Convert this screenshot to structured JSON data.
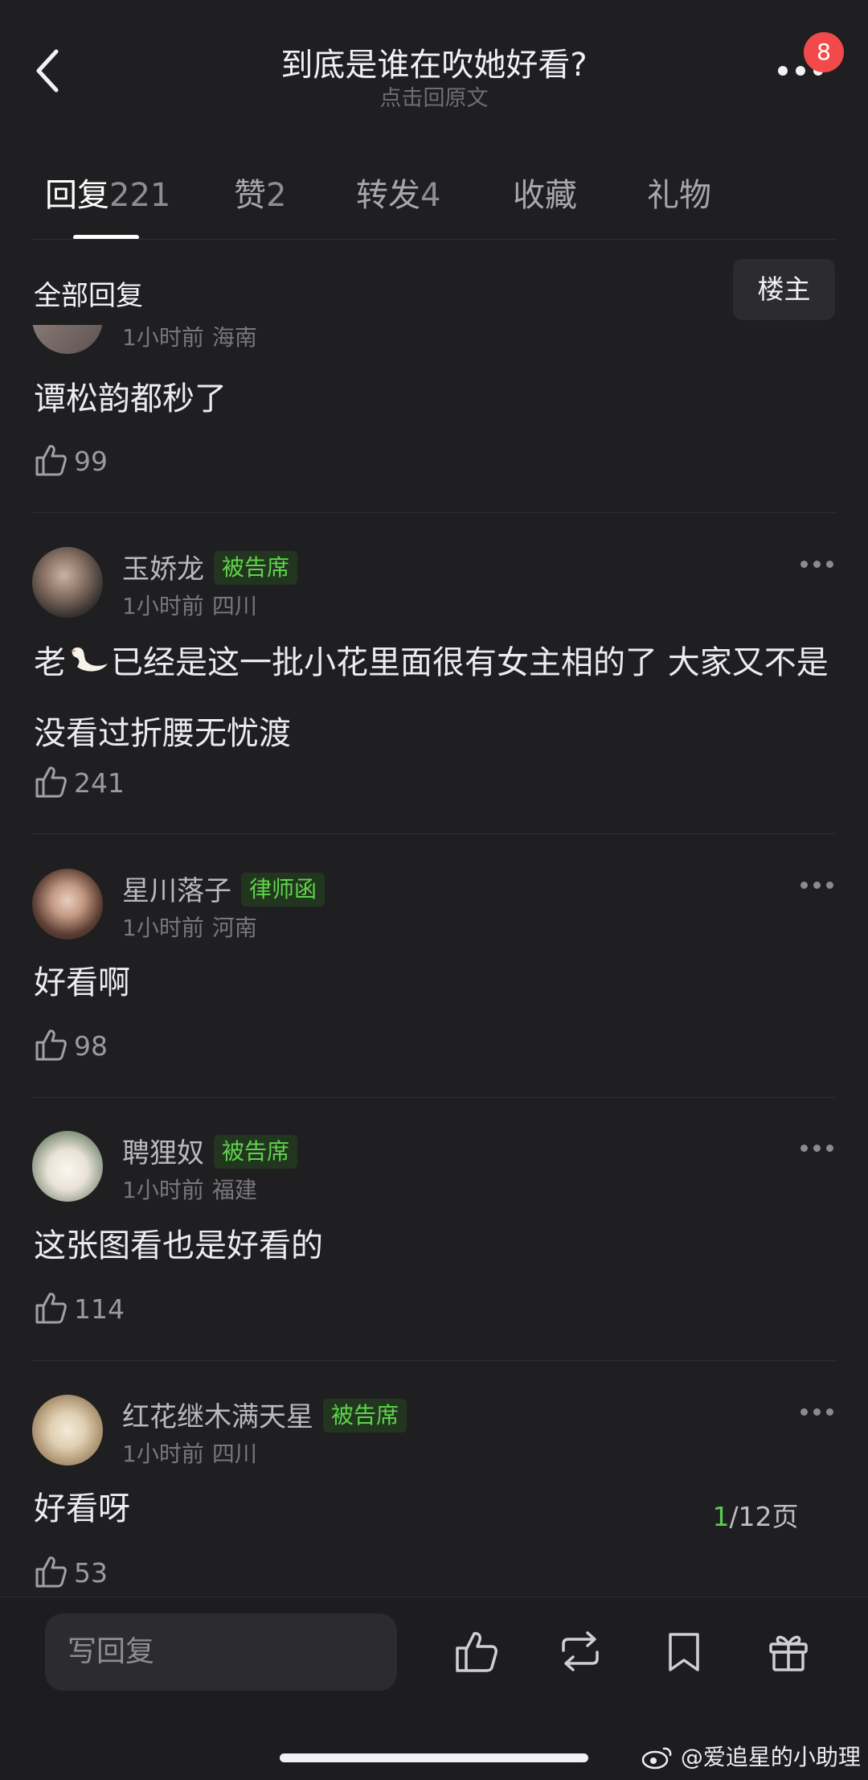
{
  "header": {
    "title": "到底是谁在吹她好看?",
    "subtitle": "点击回原文",
    "notification_count": "8"
  },
  "tabs": [
    {
      "label": "回复",
      "count": "221"
    },
    {
      "label": "赞",
      "count": "2"
    },
    {
      "label": "转发",
      "count": "4"
    },
    {
      "label": "收藏",
      "count": ""
    },
    {
      "label": "礼物",
      "count": ""
    }
  ],
  "filter": {
    "label": "全部回复",
    "op_button": "楼主"
  },
  "comments": [
    {
      "meta_time": "1小时前",
      "meta_loc": "海南",
      "text": "谭松韵都秒了",
      "likes": "99"
    },
    {
      "name": "玉娇龙",
      "tag": "被告席",
      "meta_time": "1小时前",
      "meta_loc": "四川",
      "text_a": "老",
      "text_b": "已经是这一批小花里面很有女主相的了 大家又不是没看过折腰无忧渡",
      "emoji": "swan",
      "likes": "241"
    },
    {
      "name": "星川落子",
      "tag": "律师函",
      "meta_time": "1小时前",
      "meta_loc": "河南",
      "text": "好看啊",
      "likes": "98"
    },
    {
      "name": "聘狸奴",
      "tag": "被告席",
      "meta_time": "1小时前",
      "meta_loc": "福建",
      "text": "这张图看也是好看的",
      "likes": "114"
    },
    {
      "name": "红花继木满天星",
      "tag": "被告席",
      "meta_time": "1小时前",
      "meta_loc": "四川",
      "text": "好看呀",
      "likes": "53"
    }
  ],
  "pager": {
    "current": "1",
    "rest": "/12页"
  },
  "bottom_bar": {
    "reply_placeholder": "写回复",
    "icons": [
      "like-icon",
      "repost-icon",
      "bookmark-icon",
      "gift-icon"
    ]
  },
  "watermark": "@爱追星的小助理",
  "colors": {
    "background": "#1f1f22",
    "tag_green": "#5ed34a",
    "badge_red": "#f24a4a"
  }
}
